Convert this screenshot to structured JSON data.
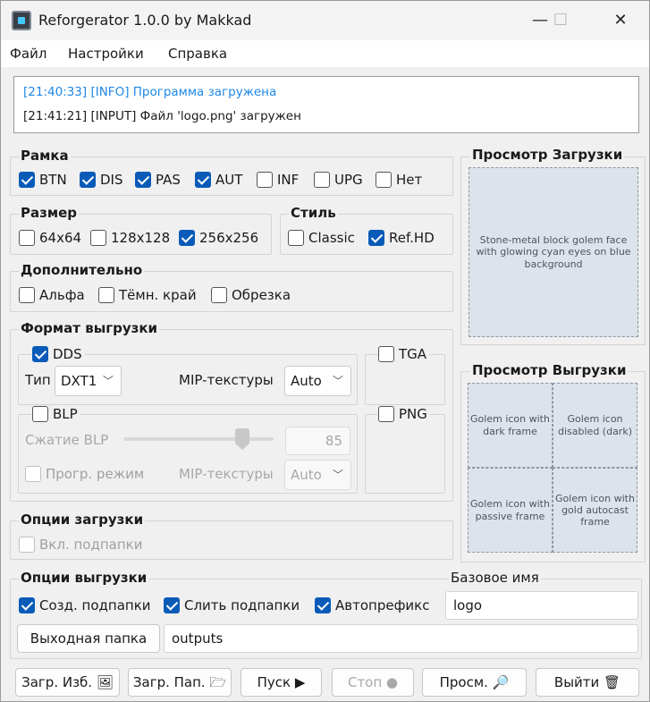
{
  "window": {
    "title": "Reforgerator 1.0.0 by Makkad",
    "icon": "app-icon",
    "minimize": "—",
    "maximize": "☐",
    "close": "✕"
  },
  "menu": {
    "file": "Файл",
    "settings": "Настройки",
    "help": "Справка"
  },
  "log": [
    {
      "text": "[21:40:33] [INFO] Программа загружена",
      "color": "#1e88e5"
    },
    {
      "text": "[21:41:21] [INPUT] Файл 'logo.png' загружен",
      "color": "#1a1a1a"
    }
  ],
  "frame": {
    "label": "Рамка",
    "options": [
      {
        "label": "BTN",
        "checked": true
      },
      {
        "label": "DIS",
        "checked": true
      },
      {
        "label": "PAS",
        "checked": true
      },
      {
        "label": "AUT",
        "checked": true
      },
      {
        "label": "INF",
        "checked": false
      },
      {
        "label": "UPG",
        "checked": false
      },
      {
        "label": "Нет",
        "checked": false
      }
    ]
  },
  "size": {
    "label": "Размер",
    "options": [
      {
        "label": "64x64",
        "checked": false
      },
      {
        "label": "128x128",
        "checked": false
      },
      {
        "label": "256x256",
        "checked": true
      }
    ]
  },
  "style": {
    "label": "Стиль",
    "options": [
      {
        "label": "Classic",
        "checked": false
      },
      {
        "label": "Ref.HD",
        "checked": true
      }
    ]
  },
  "extra": {
    "label": "Дополнительно",
    "options": [
      {
        "label": "Альфа",
        "checked": false
      },
      {
        "label": "Тёмн. край",
        "checked": false
      },
      {
        "label": "Обрезка",
        "checked": false
      }
    ]
  },
  "export_format": {
    "label": "Формат выгрузки",
    "dds": {
      "label": "DDS",
      "checked": true,
      "type_label": "Тип",
      "type_value": "DXT1",
      "mip_label": "MIP-текстуры",
      "mip_value": "Auto"
    },
    "tga": {
      "label": "TGA",
      "checked": false
    },
    "blp": {
      "label": "BLP",
      "checked": false,
      "compression_label": "Сжатие BLP",
      "compression_value": "85",
      "compression_fraction": 0.85,
      "progressive_label": "Прогр. режим",
      "mip_label": "MIP-текстуры",
      "mip_value": "Auto"
    },
    "png": {
      "label": "PNG",
      "checked": false
    }
  },
  "load_options": {
    "label": "Опции загрузки",
    "subfolders": {
      "label": "Вкл. подпапки",
      "checked": false
    }
  },
  "export_options": {
    "label": "Опции выгрузки",
    "create_subfolders": {
      "label": "Созд. подпапки",
      "checked": true
    },
    "merge_subfolders": {
      "label": "Слить подпапки",
      "checked": true
    },
    "autoprefix": {
      "label": "Автопрефикс",
      "checked": true
    },
    "base_name_label": "Базовое имя",
    "base_name_value": "logo",
    "output_folder_button": "Выходная папка",
    "output_folder_value": "outputs"
  },
  "preview": {
    "load_label": "Просмотр Загрузки",
    "load_image_desc": "Stone-metal block golem face with glowing cyan eyes on blue background",
    "export_label": "Просмотр Выгрузки",
    "export_tiles": [
      "Golem icon with dark frame",
      "Golem icon disabled (dark)",
      "Golem icon with passive frame",
      "Golem icon with gold autocast frame"
    ]
  },
  "buttons": {
    "load_file": "Загр. Изб. 🖼",
    "load_folder": "Загр. Пап. 🗁",
    "start": "Пуск ▶",
    "stop": "Стоп ●",
    "view": "Просм. 🔎",
    "exit": "Выйти 🗑"
  }
}
